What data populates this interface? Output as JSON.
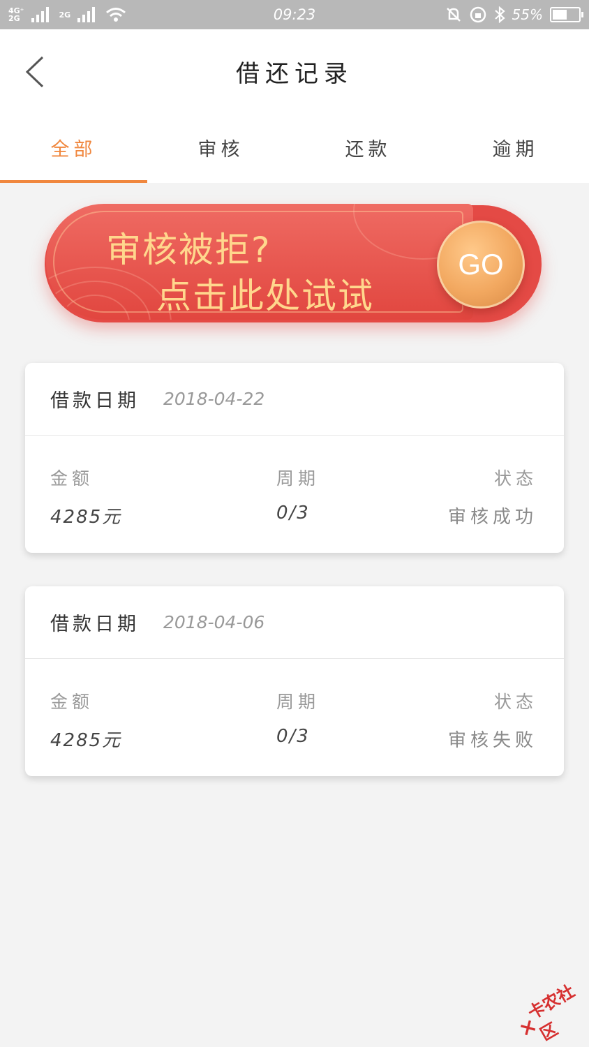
{
  "status_bar": {
    "network_line1": "4G⁺",
    "network_line2": "2G",
    "network2": "2G",
    "time": "09:23",
    "battery_percent": "55%",
    "battery_level": 0.55
  },
  "header": {
    "title": "借还记录"
  },
  "tabs": [
    {
      "label": "全部",
      "active": true
    },
    {
      "label": "审核",
      "active": false
    },
    {
      "label": "还款",
      "active": false
    },
    {
      "label": "逾期",
      "active": false
    }
  ],
  "banner": {
    "line1": "审核被拒?",
    "line2": "点击此处试试",
    "go_label": "GO"
  },
  "records": [
    {
      "date_label": "借款日期",
      "date": "2018-04-22",
      "amount_label": "金额",
      "amount": "4285元",
      "period_label": "周期",
      "period": "0/3",
      "status_label": "状态",
      "status": "审核成功"
    },
    {
      "date_label": "借款日期",
      "date": "2018-04-06",
      "amount_label": "金额",
      "amount": "4285元",
      "period_label": "周期",
      "period": "0/3",
      "status_label": "状态",
      "status": "审核失败"
    }
  ],
  "watermark": {
    "text": "卡农社区"
  },
  "colors": {
    "accent": "#f0873e",
    "banner_red": "#e44a45",
    "banner_text": "#ffd78d"
  }
}
